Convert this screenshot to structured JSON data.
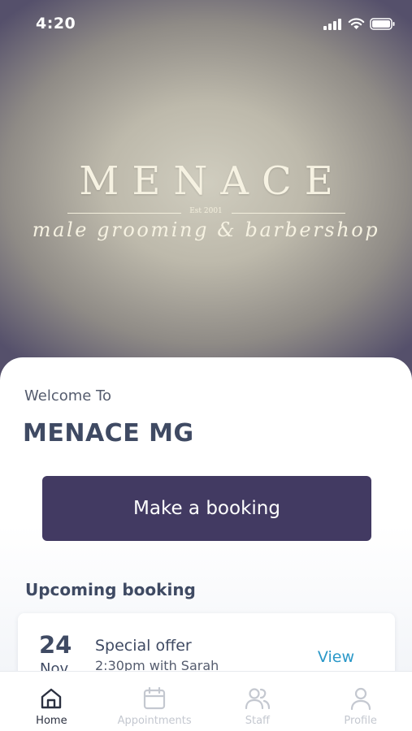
{
  "status_bar": {
    "time": "4:20"
  },
  "hero": {
    "logo_main": "MENACE",
    "logo_est": "Est 2001",
    "logo_sub": "male grooming & barbershop"
  },
  "welcome": {
    "label": "Welcome To",
    "business_name": "MENACE MG"
  },
  "booking_button": {
    "label": "Make a booking"
  },
  "upcoming": {
    "title": "Upcoming booking",
    "booking": {
      "day": "24",
      "month": "Nov",
      "title": "Special offer",
      "detail": "2:30pm with Sarah",
      "action": "View"
    }
  },
  "tab_bar": {
    "tabs": [
      {
        "label": "Home",
        "icon": "home-icon",
        "active": true
      },
      {
        "label": "Appointments",
        "icon": "calendar-icon",
        "active": false
      },
      {
        "label": "Staff",
        "icon": "staff-icon",
        "active": false
      },
      {
        "label": "Profile",
        "icon": "profile-icon",
        "active": false
      }
    ]
  },
  "colors": {
    "primary": "#423a62",
    "heading": "#3f4a63",
    "link": "#2a98c8",
    "inactive_tab": "#c4c8d0"
  }
}
